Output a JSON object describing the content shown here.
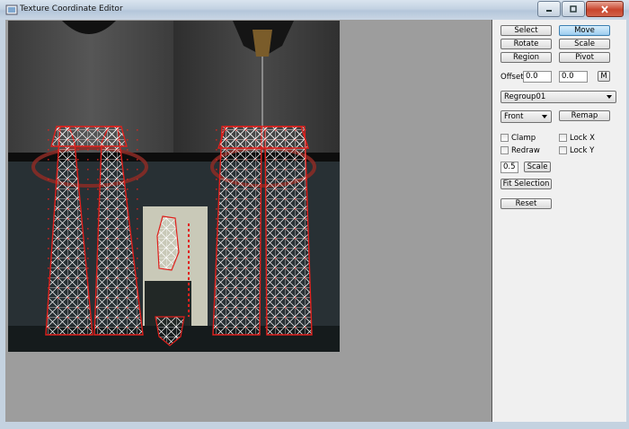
{
  "window": {
    "title": "Texture Coordinate Editor"
  },
  "panel": {
    "mode_buttons": {
      "select": "Select",
      "move": "Move",
      "rotate": "Rotate",
      "scale": "Scale",
      "region": "Region",
      "pivot": "Pivot"
    },
    "active_mode": "Move",
    "offset_label": "Offset:",
    "offset_x": "0.0",
    "offset_y": "0.0",
    "m_button": "M",
    "regroup_select": "Regroup01",
    "view_select": "Front",
    "remap_button": "Remap",
    "clamp_label": "Clamp",
    "lockx_label": "Lock X",
    "redraw_label": "Redraw",
    "locky_label": "Lock Y",
    "scale_value": "0.5",
    "scale_button": "Scale",
    "fit_selection_button": "Fit Selection",
    "reset_button": "Reset"
  },
  "colors": {
    "accent": "#9dcdf0",
    "uv_wire": "#ffffff",
    "uv_vertex": "#e0201c",
    "close": "#c8452d"
  }
}
